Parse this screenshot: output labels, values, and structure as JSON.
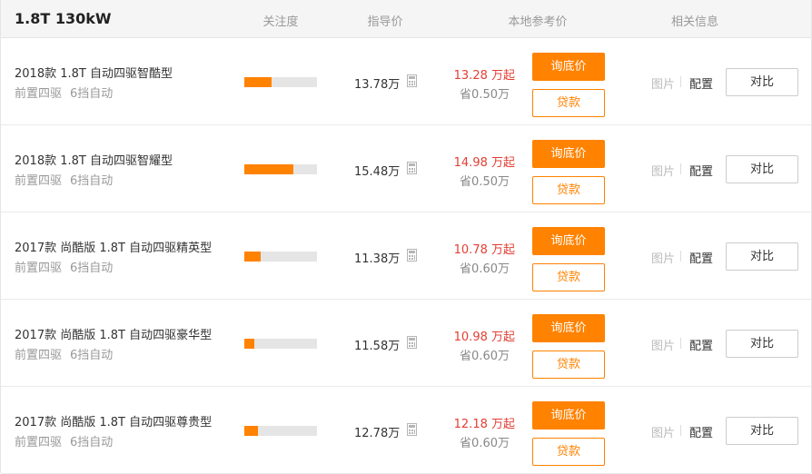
{
  "header": {
    "engine": "1.8T 130kW",
    "col_attention": "关注度",
    "col_guide_price": "指导价",
    "col_local_price": "本地参考价",
    "col_info": "相关信息"
  },
  "labels": {
    "inquire": "询底价",
    "loan": "贷款",
    "pictures": "图片",
    "config": "配置",
    "compare": "对比"
  },
  "colors": {
    "accent": "#ff8200",
    "price_red": "#e33e33"
  },
  "rows": [
    {
      "name": "2018款 1.8T 自动四驱智酷型",
      "drive": "前置四驱",
      "gearbox": "6挡自动",
      "attention": 0.37,
      "guide_price": "13.78万",
      "local_price": "13.28 万起",
      "save": "省0.50万"
    },
    {
      "name": "2018款 1.8T 自动四驱智耀型",
      "drive": "前置四驱",
      "gearbox": "6挡自动",
      "attention": 0.68,
      "guide_price": "15.48万",
      "local_price": "14.98 万起",
      "save": "省0.50万"
    },
    {
      "name": "2017款 尚酷版 1.8T 自动四驱精英型",
      "drive": "前置四驱",
      "gearbox": "6挡自动",
      "attention": 0.22,
      "guide_price": "11.38万",
      "local_price": "10.78 万起",
      "save": "省0.60万"
    },
    {
      "name": "2017款 尚酷版 1.8T 自动四驱豪华型",
      "drive": "前置四驱",
      "gearbox": "6挡自动",
      "attention": 0.14,
      "guide_price": "11.58万",
      "local_price": "10.98 万起",
      "save": "省0.60万"
    },
    {
      "name": "2017款 尚酷版 1.8T 自动四驱尊贵型",
      "drive": "前置四驱",
      "gearbox": "6挡自动",
      "attention": 0.19,
      "guide_price": "12.78万",
      "local_price": "12.18 万起",
      "save": "省0.60万"
    }
  ]
}
